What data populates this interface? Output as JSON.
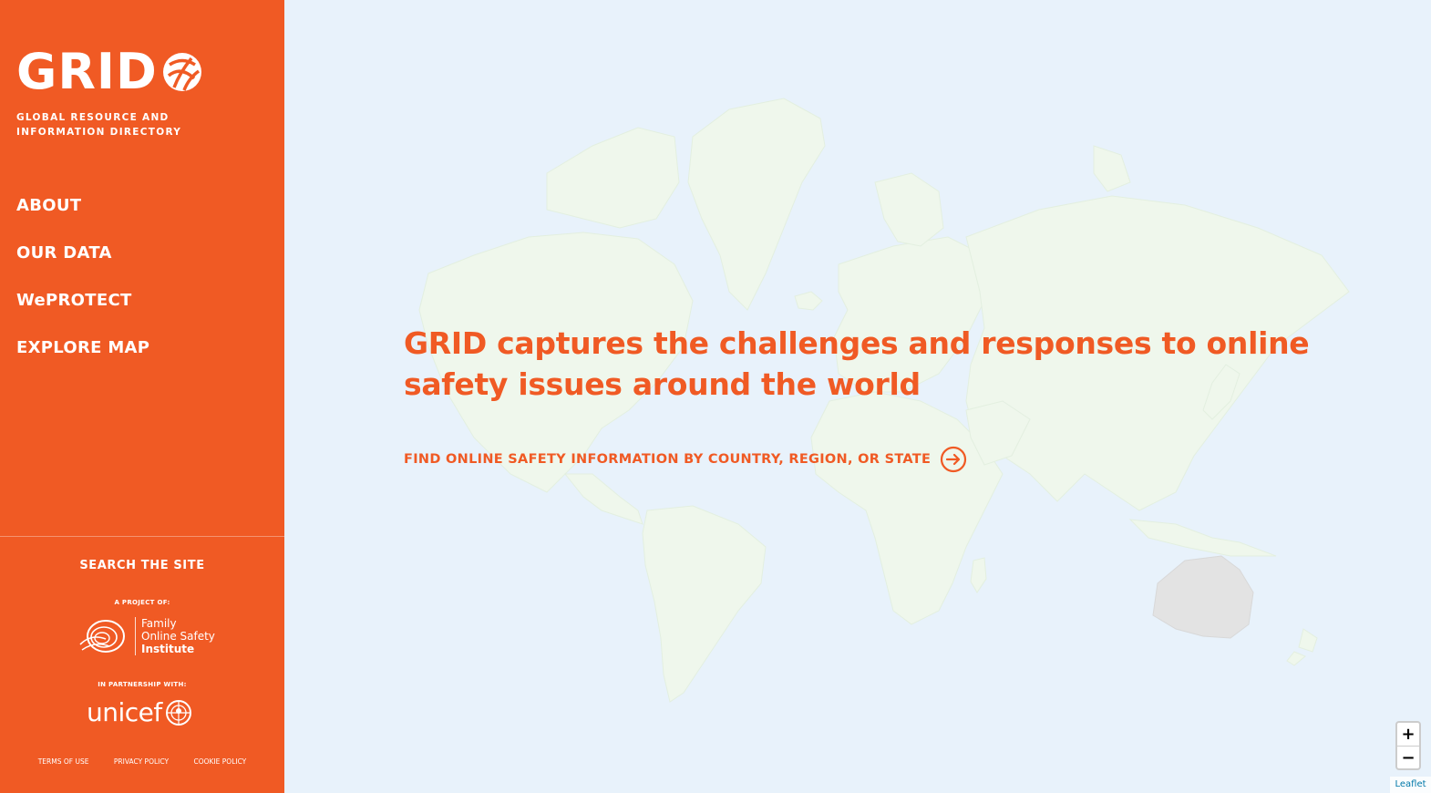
{
  "brand": {
    "logo_text": "GRID",
    "tagline": "GLOBAL RESOURCE AND INFORMATION DIRECTORY",
    "accent_color": "#f05a24"
  },
  "nav": {
    "items": [
      {
        "label": "ABOUT"
      },
      {
        "label": "OUR DATA"
      },
      {
        "label": "WePROTECT"
      },
      {
        "label": "EXPLORE MAP"
      }
    ]
  },
  "sidebar_footer": {
    "search_label": "SEARCH THE SITE",
    "project_of_label": "A PROJECT OF:",
    "fosi_lines": [
      "Family",
      "Online Safety",
      "Institute"
    ],
    "partnership_label": "IN PARTNERSHIP WITH:",
    "unicef_label": "unicef",
    "links": [
      "TERMS OF USE",
      "PRIVACY POLICY",
      "COOKIE POLICY"
    ]
  },
  "hero": {
    "headline": "GRID captures the challenges and responses to online safety issues around the world",
    "cta_label": "FIND ONLINE SAFETY INFORMATION BY COUNTRY, REGION, OR STATE"
  },
  "map_controls": {
    "zoom_in": "+",
    "zoom_out": "−",
    "attribution": "Leaflet"
  }
}
